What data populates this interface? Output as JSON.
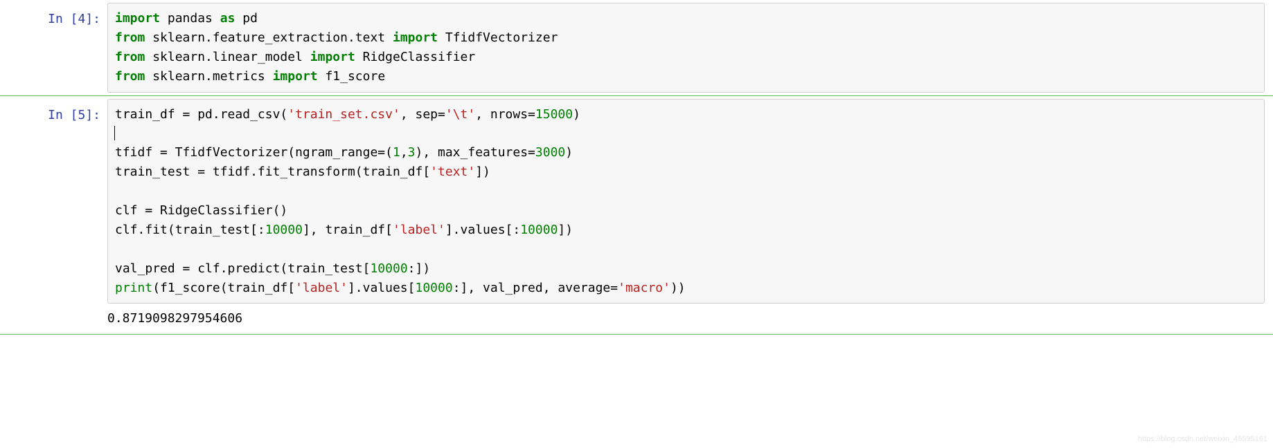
{
  "cells": {
    "cell4": {
      "prompt": "In [4]:",
      "code": {
        "l1": {
          "t1": "import",
          "t2": " pandas ",
          "t3": "as",
          "t4": " pd"
        },
        "l2": {
          "t1": "from",
          "t2": " sklearn.feature_extraction.text ",
          "t3": "import",
          "t4": " TfidfVectorizer"
        },
        "l3": {
          "t1": "from",
          "t2": " sklearn.linear_model ",
          "t3": "import",
          "t4": " RidgeClassifier"
        },
        "l4": {
          "t1": "from",
          "t2": " sklearn.metrics ",
          "t3": "import",
          "t4": " f1_score"
        }
      }
    },
    "cell5": {
      "prompt": "In [5]:",
      "code": {
        "l1": {
          "a": "train_df = pd.read_csv(",
          "b": "'train_set.csv'",
          "c": ", sep=",
          "d": "'\\t'",
          "e": ", nrows=",
          "f": "15000",
          "g": ")"
        },
        "l2": "",
        "l3": {
          "a": "tfidf = TfidfVectorizer(ngram_range=(",
          "b": "1",
          "c": ",",
          "d": "3",
          "e": "), max_features=",
          "f": "3000",
          "g": ")"
        },
        "l4": {
          "a": "train_test = tfidf.fit_transform(train_df[",
          "b": "'text'",
          "c": "])"
        },
        "l5": "",
        "l6": {
          "a": "clf = RidgeClassifier()"
        },
        "l7": {
          "a": "clf.fit(train_test[:",
          "b": "10000",
          "c": "], train_df[",
          "d": "'label'",
          "e": "].values[:",
          "f": "10000",
          "g": "])"
        },
        "l8": "",
        "l9": {
          "a": "val_pred = clf.predict(train_test[",
          "b": "10000",
          "c": ":])"
        },
        "l10": {
          "a": "print",
          "b": "(f1_score(train_df[",
          "c": "'label'",
          "d": "].values[",
          "e": "10000",
          "f": ":], val_pred, average=",
          "g": "'macro'",
          "h": "))"
        }
      },
      "output": "0.8719098297954606"
    }
  },
  "watermark": "https://blog.csdn.net/weixin_45595161"
}
